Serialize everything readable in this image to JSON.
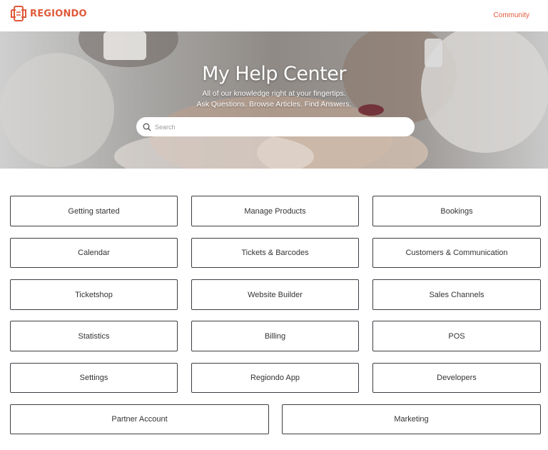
{
  "brand": {
    "name": "REGIONDO",
    "color": "#e05a3a"
  },
  "nav": {
    "community_label": "Community"
  },
  "hero": {
    "title": "My Help Center",
    "subtitle_line1": "All of our knowledge right at your fingertips.",
    "subtitle_line2": "Ask Questions. Browse Articles. Find Answers."
  },
  "search": {
    "placeholder": "Search",
    "value": "",
    "icon": "search-icon"
  },
  "categories": [
    "Getting started",
    "Manage Products",
    "Bookings",
    "Calendar",
    "Tickets & Barcodes",
    "Customers & Communication",
    "Ticketshop",
    "Website Builder",
    "Sales Channels",
    "Statistics",
    "Billing",
    "POS",
    "Settings",
    "Regiondo App",
    "Developers",
    "Partner Account",
    "Marketing"
  ]
}
